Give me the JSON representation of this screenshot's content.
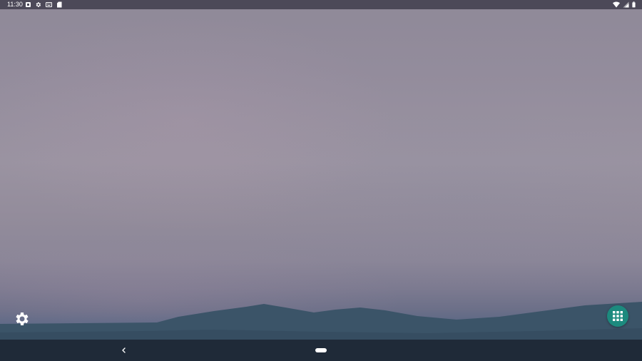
{
  "status_bar": {
    "time": "11:30",
    "left_icons": [
      "notification-square-icon",
      "gear-icon",
      "keyboard-icon",
      "sd-card-icon"
    ],
    "right_icons": [
      "wifi-icon",
      "cell-signal-icon",
      "battery-icon"
    ]
  },
  "home_screen": {
    "wallpaper": "dusk-sky-with-mountains",
    "shortcuts": [
      {
        "name": "settings",
        "icon": "gear-icon"
      },
      {
        "name": "all-apps",
        "icon": "app-grid-icon"
      }
    ]
  },
  "navigation_bar": {
    "buttons": [
      "back-icon",
      "home-pill"
    ]
  },
  "colors": {
    "status_bar": "#4c4958",
    "nav_bar": "#1f2a38",
    "apps_button": "#1c8a7e",
    "hills": "#3d5468"
  }
}
